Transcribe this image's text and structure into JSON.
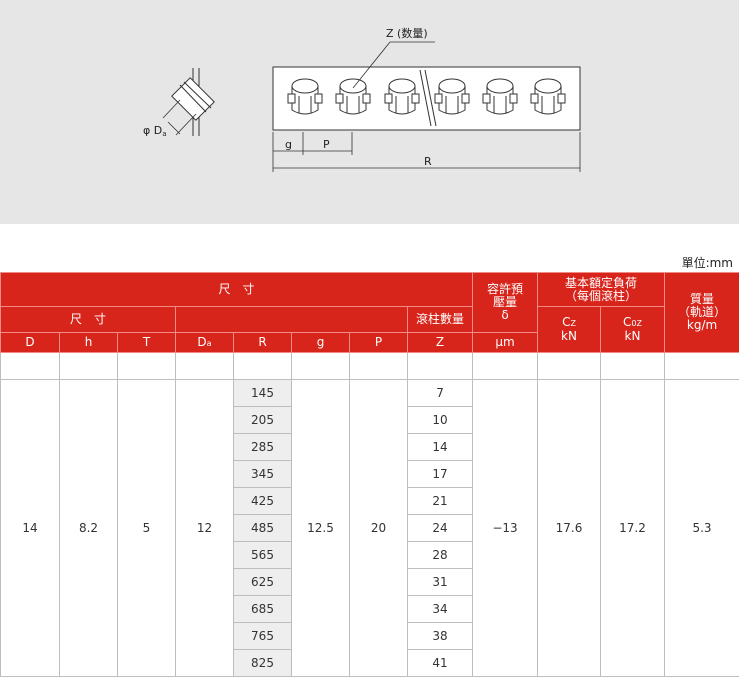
{
  "diagram": {
    "label_z": "Z (数量)",
    "label_da": "φ D",
    "label_da_sub": "a",
    "label_g": "g",
    "label_p": "P",
    "label_r": "R"
  },
  "unit_note": "單位:mm",
  "header": {
    "dimensions": "尺　寸",
    "sub_dimensions": "尺　寸",
    "roller_count": "滾柱數量",
    "preload_l1": "容許預",
    "preload_l2": "壓量",
    "preload_symbol": "δ",
    "preload_unit": "μm",
    "load_l1": "基本額定負荷",
    "load_l2": "（每個滾柱）",
    "mass_l1": "質量",
    "mass_l2": "（軌道）",
    "mass_unit": "kg/m",
    "col_d": "D",
    "col_h": "h",
    "col_t": "T",
    "col_da": "D",
    "col_da_sub": "a",
    "col_r": "R",
    "col_g": "g",
    "col_p": "P",
    "col_z": "Z",
    "col_c": "C",
    "col_c_sub": "Z",
    "col_c_unit": "kN",
    "col_c0": "C",
    "col_c0_sub": "0Z",
    "col_c0_unit": "kN"
  },
  "row_common": {
    "D": "14",
    "h": "8.2",
    "T": "5",
    "Da": "12",
    "g": "12.5",
    "P": "20",
    "delta": "−13",
    "Cz": "17.6",
    "C0z": "17.2",
    "mass": "5.3"
  },
  "rows": [
    {
      "R": "145",
      "Z": "7"
    },
    {
      "R": "205",
      "Z": "10"
    },
    {
      "R": "285",
      "Z": "14"
    },
    {
      "R": "345",
      "Z": "17"
    },
    {
      "R": "425",
      "Z": "21"
    },
    {
      "R": "485",
      "Z": "24"
    },
    {
      "R": "565",
      "Z": "28"
    },
    {
      "R": "625",
      "Z": "31"
    },
    {
      "R": "685",
      "Z": "34"
    },
    {
      "R": "765",
      "Z": "38"
    },
    {
      "R": "825",
      "Z": "41"
    }
  ]
}
